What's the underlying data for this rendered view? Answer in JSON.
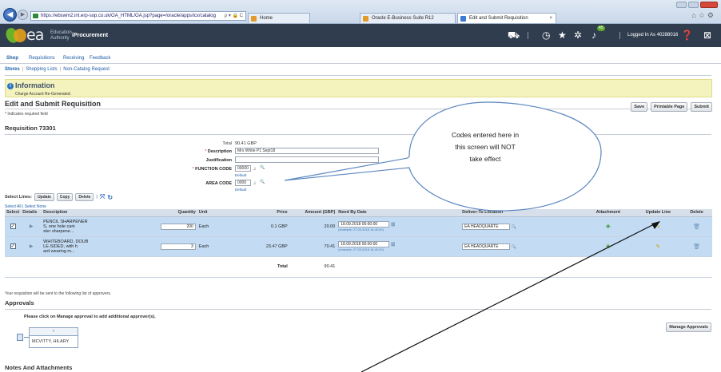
{
  "browser": {
    "url": "https://ebswm2.int.erp-sop.co.uk/OA_HTML/OA.jsp?page=/oracle/apps/icx/catalog",
    "url_tools": "ρ ▾ 🔒 C",
    "tabs": [
      {
        "label": "Home",
        "active": false
      },
      {
        "label": "Oracle E-Business Suite R12",
        "active": false
      },
      {
        "label": "Edit and Submit Requisition",
        "active": true
      }
    ],
    "tab_close": "×"
  },
  "header": {
    "logo_text": "ea",
    "logo_sub_1": "Education",
    "logo_sub_2": "Authority",
    "app_name": "iProcurement",
    "notification_count": "45",
    "logged_in": "Logged In As 40288016"
  },
  "nav": {
    "tabs": [
      "Shop",
      "Requisitions",
      "Receiving",
      "Feedback"
    ],
    "subtabs": [
      "Stores",
      "Shopping Lists",
      "Non-Catalog Request"
    ]
  },
  "info": {
    "title": "Information",
    "message": "Charge Account Re-Generated."
  },
  "page": {
    "title": "Edit and Submit Requisition",
    "required_note": "* Indicates required field",
    "buttons": {
      "save": "Save",
      "printable": "Printable Page",
      "submit": "Submit"
    },
    "requisition_title": "Requisition 73301"
  },
  "form": {
    "total_label": "Total",
    "total_value": "90.41 GBP",
    "description_label": "Description",
    "description_value": "Mrs White P1 Sept18",
    "justification_label": "Justification",
    "function_code_label": "FUNCTION CODE",
    "function_code_value": "00000",
    "function_default": "Default",
    "area_code_label": "AREA CODE",
    "area_code_value": "0000",
    "area_default": "Default"
  },
  "callout": {
    "line1": "Codes entered here in",
    "line2": "this screen will NOT",
    "line3": "take effect"
  },
  "lines": {
    "select_label": "Select Lines:",
    "buttons": {
      "update": "Update",
      "copy": "Copy",
      "delete": "Delete"
    },
    "select_all": "Select All | Select None",
    "columns": [
      "Select",
      "Details",
      "Description",
      "Quantity",
      "Unit",
      "Price",
      "Amount (GBP)",
      "Need By Date",
      "Deliver-To Location",
      "Attachment",
      "Update Line",
      "Delete"
    ],
    "rows": [
      {
        "description_1": "PENCIL SHARPENER",
        "description_2": "S, one hole cani",
        "description_3": "ster sharpene...",
        "quantity": "200",
        "unit": "Each",
        "price": "0.1 GBP",
        "amount": "20.00",
        "need_by": "18.09.2018 00:00:00",
        "example": "(example: 27.09.2018 16:40:00)",
        "deliver_to": "EA HEADQUARTE"
      },
      {
        "description_1": "WHITEBOARD, DOUB",
        "description_2": "LE-SIDED, with h",
        "description_3": "ard wearing m...",
        "quantity": "3",
        "unit": "Each",
        "price": "23.47 GBP",
        "amount": "70.41",
        "need_by": "18.09.2018 00:00:00",
        "example": "(example: 27.09.2018 16:40:00)",
        "deliver_to": "EA HEADQUARTE"
      }
    ],
    "total_label": "Total",
    "total_value": "90.41"
  },
  "approvals": {
    "note": "Your requisition will be sent to the following list of approvers.",
    "title": "Approvals",
    "instruction": "Please click on Manage approval to add additional approver(s).",
    "manage_button": "Manage Approvals",
    "approver": "MCVITTY, HILARY"
  },
  "notes": {
    "title": "Notes And Attachments"
  },
  "icons": [
    "back-icon",
    "forward-icon",
    "lock-icon",
    "cart-icon",
    "clock-icon",
    "star-icon",
    "gear-icon",
    "bell-icon",
    "help-icon",
    "logout-icon",
    "checkbox-icon",
    "expand-icon",
    "search-icon",
    "calendar-icon",
    "attachment-icon",
    "pencil-icon",
    "trash-icon"
  ]
}
